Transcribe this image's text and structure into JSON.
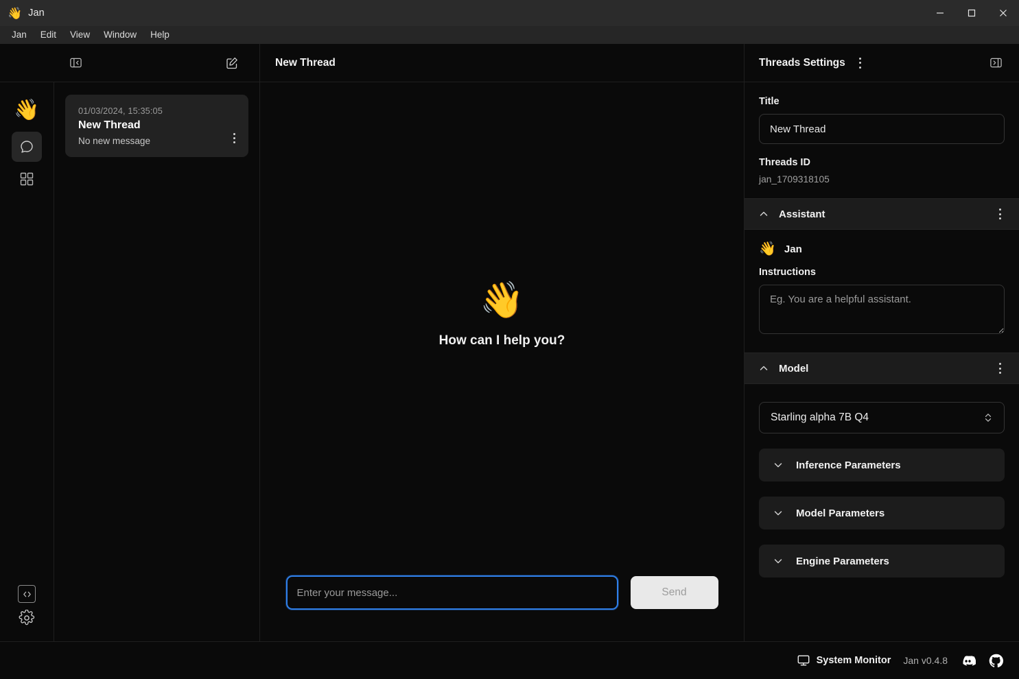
{
  "window": {
    "app_emoji": "👋",
    "app_title": "Jan",
    "minimize_label": "Minimize",
    "maximize_label": "Maximize",
    "close_label": "Close"
  },
  "menubar": {
    "items": [
      {
        "label": "Jan"
      },
      {
        "label": "Edit"
      },
      {
        "label": "View"
      },
      {
        "label": "Window"
      },
      {
        "label": "Help"
      }
    ]
  },
  "toolbar": {
    "collapse_panel_icon": "panel-left-collapse-icon",
    "new_thread_icon": "compose-icon",
    "thread_title": "New Thread"
  },
  "rail": {
    "logo_emoji": "👋",
    "items": [
      {
        "name": "chat",
        "icon": "chat-bubble-icon",
        "active": true
      },
      {
        "name": "hub",
        "icon": "grid-icon",
        "active": false
      }
    ],
    "bottom": [
      {
        "name": "local-api-server",
        "icon": "code-brackets-icon"
      },
      {
        "name": "settings",
        "icon": "gear-icon"
      }
    ]
  },
  "threads": {
    "list": [
      {
        "date": "01/03/2024, 15:35:05",
        "title": "New Thread",
        "subtitle": "No new message"
      }
    ]
  },
  "chat": {
    "welcome_emoji": "👋",
    "welcome_text": "How can I help you?",
    "input_placeholder": "Enter your message...",
    "input_value": "",
    "send_label": "Send"
  },
  "settings": {
    "panel_title": "Threads Settings",
    "panel_kebab_icon": "more-vertical-icon",
    "collapse_icon": "panel-right-collapse-icon",
    "title_label": "Title",
    "title_value": "New Thread",
    "threads_id_label": "Threads ID",
    "threads_id_value": "jan_1709318105",
    "assistant": {
      "band_label": "Assistant",
      "emoji": "👋",
      "name": "Jan",
      "instructions_label": "Instructions",
      "instructions_placeholder": "Eg. You are a helpful assistant.",
      "instructions_value": ""
    },
    "model": {
      "band_label": "Model",
      "selected": "Starling alpha 7B Q4",
      "parameters": [
        {
          "label": "Inference Parameters"
        },
        {
          "label": "Model Parameters"
        },
        {
          "label": "Engine Parameters"
        }
      ]
    }
  },
  "statusbar": {
    "system_monitor_label": "System Monitor",
    "version": "Jan v0.4.8",
    "discord_icon": "discord-icon",
    "github_icon": "github-icon"
  },
  "colors": {
    "background": "#0a0a0a",
    "titlebar": "#2b2b2b",
    "menubar": "#262626",
    "panel_band": "#1c1c1c",
    "card": "#222222",
    "focus_ring": "#2f7fe8",
    "send_button": "#e9e9e9",
    "accent_emoji": "#f5c445"
  }
}
